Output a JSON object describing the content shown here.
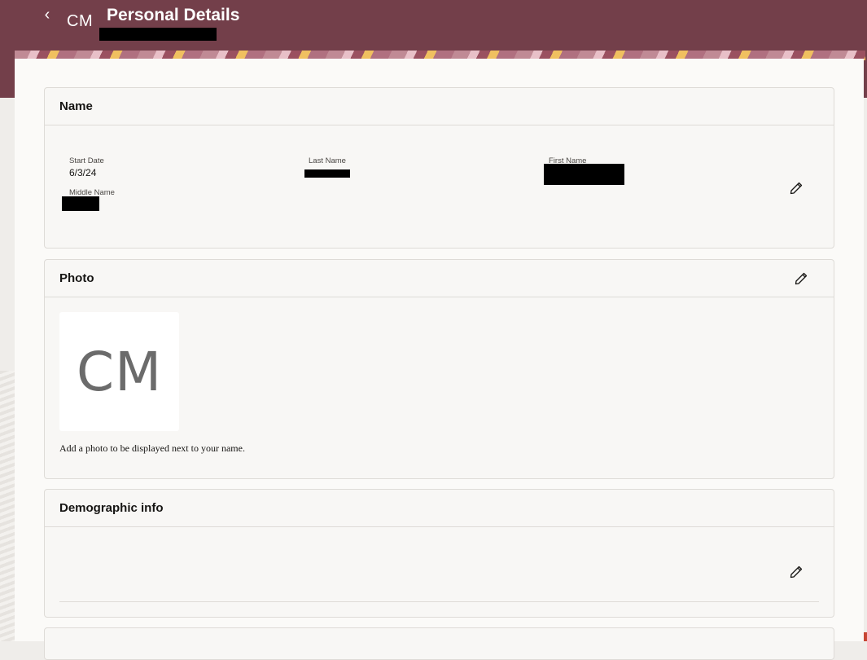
{
  "header": {
    "back_label": "‹",
    "avatar_initials": "CM",
    "title": "Personal Details"
  },
  "name_card": {
    "title": "Name",
    "fields": {
      "start_date_label": "Start Date",
      "start_date_value": "6/3/24",
      "last_name_label": "Last Name",
      "first_name_label": "First Name",
      "middle_name_label": "Middle Name"
    },
    "edit_icon": "pencil-icon"
  },
  "photo_card": {
    "title": "Photo",
    "initials": "CM",
    "hint": "Add a photo to be displayed next to your name.",
    "edit_icon": "pencil-icon"
  },
  "demographic_card": {
    "title": "Demographic info",
    "edit_icon": "pencil-icon"
  },
  "colors": {
    "header_bg": "#733f4a",
    "accent": "#c74634"
  }
}
